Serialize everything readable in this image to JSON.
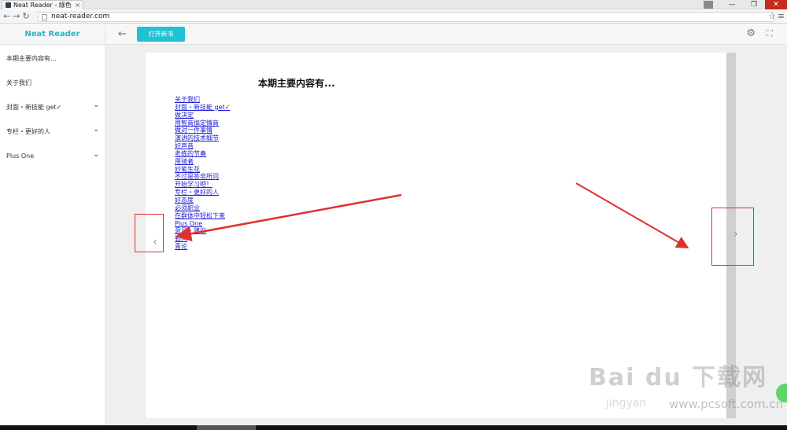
{
  "browser": {
    "tab_title": "Neat Reader - 綠色",
    "tab_close": "×",
    "url": "neat-reader.com",
    "min": "—",
    "max": "❐",
    "close": "✕"
  },
  "app": {
    "brand": "Neat Reader",
    "open_book_label": "打开新书",
    "accent": "#1ec2d2"
  },
  "sidebar": {
    "items": [
      {
        "label": "本期主要内容有...",
        "expandable": false
      },
      {
        "label": "关于我们",
        "expandable": false
      },
      {
        "label": "封面・新技能 get✓",
        "expandable": true
      },
      {
        "label": "专栏・更好的人",
        "expandable": true
      },
      {
        "label": "Plus One",
        "expandable": true
      }
    ]
  },
  "page": {
    "title": "本期主要内容有...",
    "toc": [
      "关于我们",
      "封面・新技能 get✓",
      "做决定",
      "用智商搞定情商",
      "做对一件事情",
      "演讲的技术细节",
      "好声音",
      "老练的节奏",
      "用骑者",
      "妙笔生花",
      "不过是答非所问",
      "开始学习吧！",
      "专栏・更好的人",
      "好态度",
      "必须职业",
      "在群体中轻松下来",
      "Plus One",
      "意见・建议",
      "勒问",
      "青论"
    ]
  },
  "watermark": {
    "baidu": "Bai du 下载网",
    "site": "www.pcsoft.com.cn",
    "sub": "jingyan"
  },
  "annotation_color": "#e03030"
}
